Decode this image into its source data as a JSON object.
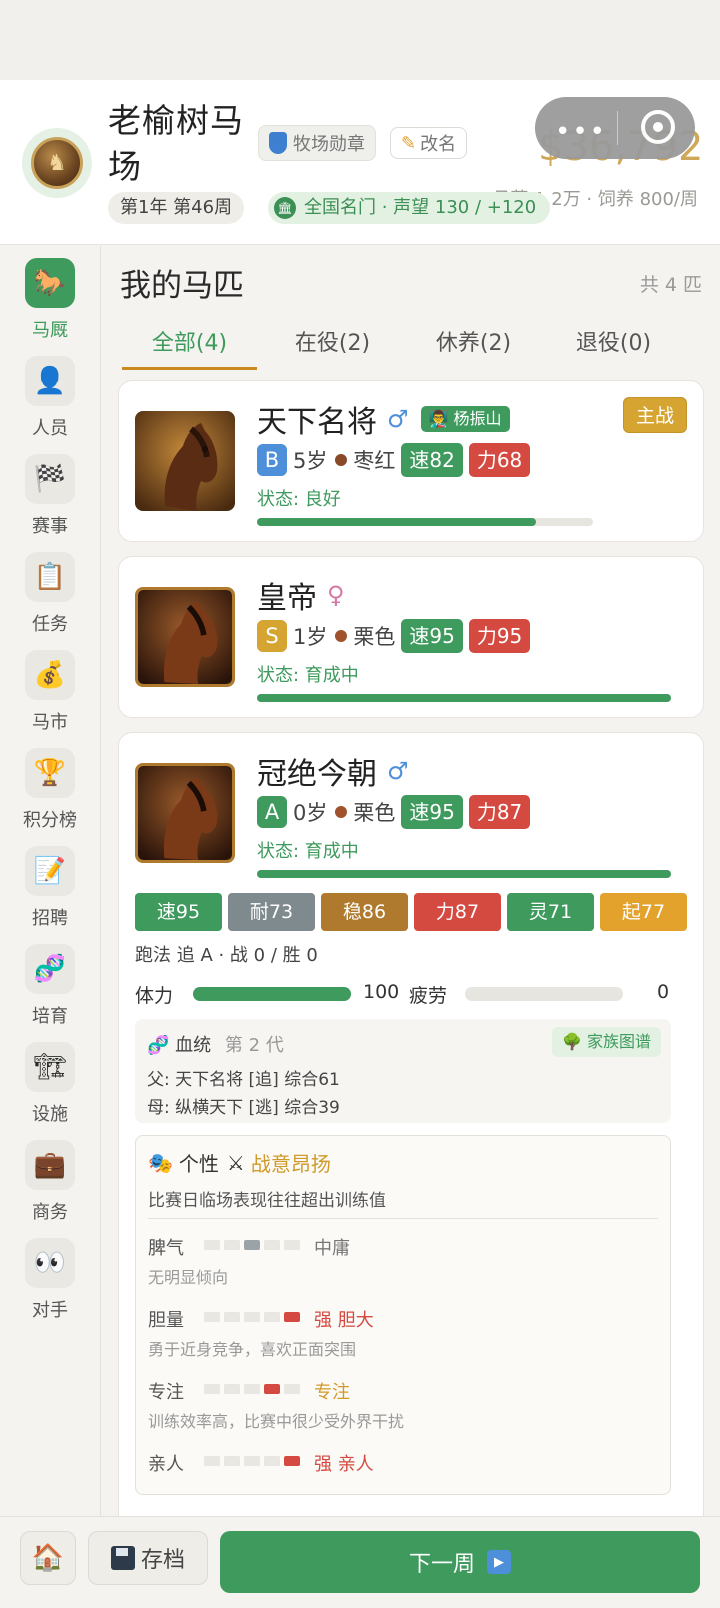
{
  "header": {
    "ranch_name": "老榆树马场",
    "medal_label": "牧场勋章",
    "rename_label": "改名",
    "money": "$36,792",
    "salary_info": "月薪 1.2万 · 饲养 800/周",
    "week": "第1年 第46周",
    "reputation": "全国名门 · 声望 130 / +120"
  },
  "sidebar": {
    "items": [
      {
        "label": "马厩",
        "icon": "🐎",
        "active": true
      },
      {
        "label": "人员",
        "icon": "👤"
      },
      {
        "label": "赛事",
        "icon": "🏁"
      },
      {
        "label": "任务",
        "icon": "📋"
      },
      {
        "label": "马市",
        "icon": "💰"
      },
      {
        "label": "积分榜",
        "icon": "🏆"
      },
      {
        "label": "招聘",
        "icon": "📝"
      },
      {
        "label": "培育",
        "icon": "🧬"
      },
      {
        "label": "设施",
        "icon": "🏗"
      },
      {
        "label": "商务",
        "icon": "💼"
      },
      {
        "label": "对手",
        "icon": "👀"
      }
    ]
  },
  "main": {
    "title": "我的马匹",
    "count": "共 4 匹",
    "tabs": [
      {
        "label": "全部(4)",
        "active": true
      },
      {
        "label": "在役(2)"
      },
      {
        "label": "休养(2)"
      },
      {
        "label": "退役(0)"
      }
    ]
  },
  "horses": [
    {
      "name": "天下名将",
      "gender": "♂",
      "jockey": "👨‍🏫 杨振山",
      "badge": "主战",
      "grade": "B",
      "age": "5岁",
      "coat": "枣红",
      "speed": "速82",
      "power": "力68",
      "status": "状态: 良好",
      "progress": 0.83
    },
    {
      "name": "皇帝",
      "gender": "♀",
      "grade": "S",
      "age": "1岁",
      "coat": "栗色",
      "speed": "速95",
      "power": "力95",
      "status": "状态: 育成中",
      "progress": 1.0
    },
    {
      "name": "冠绝今朝",
      "gender": "♂",
      "grade": "A",
      "age": "0岁",
      "coat": "栗色",
      "speed": "速95",
      "power": "力87",
      "status": "状态: 育成中",
      "progress": 1.0,
      "stats": [
        "速95",
        "耐73",
        "稳86",
        "力87",
        "灵71",
        "起77"
      ],
      "run_style": "跑法 追 A · 战 0 / 胜 0",
      "stamina_label": "体力",
      "stamina_value": "100",
      "stamina_level": 1.0,
      "fatigue_label": "疲劳",
      "fatigue_value": "0",
      "fatigue_level": 0.0,
      "lineage": {
        "title": "血统",
        "generation": "第 2 代",
        "tree_button": "家族图谱",
        "sire": "父: 天下名将 [追] 综合61",
        "dam": "母: 纵横天下 [逃] 综合39"
      },
      "personality": {
        "title": "个性",
        "trait_name": "战意昂扬",
        "description": "比赛日临场表现往往超出训练值",
        "traits": [
          {
            "name": "脾气",
            "value": "中庸",
            "desc": "无明显倾向",
            "level": 3
          },
          {
            "name": "胆量",
            "value": "强 胆大",
            "desc": "勇于近身竞争，喜欢正面突围",
            "level": 5
          },
          {
            "name": "专注",
            "value": "专注",
            "desc": "训练效率高，比赛中很少受外界干扰",
            "level": 4
          },
          {
            "name": "亲人",
            "value": "强 亲人",
            "desc": "",
            "level": 5
          }
        ]
      }
    }
  ],
  "bottom": {
    "save_label": "存档",
    "next_label": "下一周"
  }
}
